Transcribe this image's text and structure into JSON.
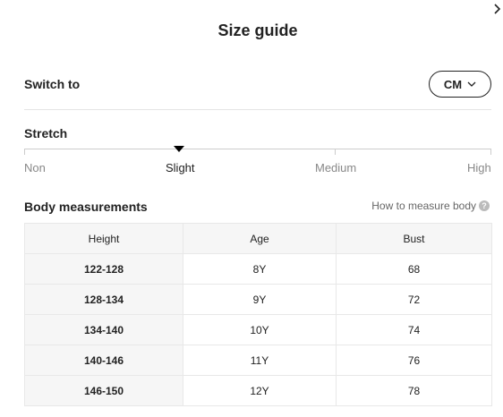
{
  "dialog": {
    "title": "Size guide"
  },
  "switch": {
    "label": "Switch to",
    "unit": "CM"
  },
  "stretch": {
    "title": "Stretch",
    "levels": [
      "Non",
      "Slight",
      "Medium",
      "High"
    ],
    "selected": "Slight"
  },
  "body_measurements": {
    "title": "Body measurements",
    "how_to_link": "How to measure body",
    "help_icon_text": "?",
    "columns": [
      "Height",
      "Age",
      "Bust"
    ],
    "rows": [
      [
        "122-128",
        "8Y",
        "68"
      ],
      [
        "128-134",
        "9Y",
        "72"
      ],
      [
        "134-140",
        "10Y",
        "74"
      ],
      [
        "140-146",
        "11Y",
        "76"
      ],
      [
        "146-150",
        "12Y",
        "78"
      ]
    ]
  }
}
